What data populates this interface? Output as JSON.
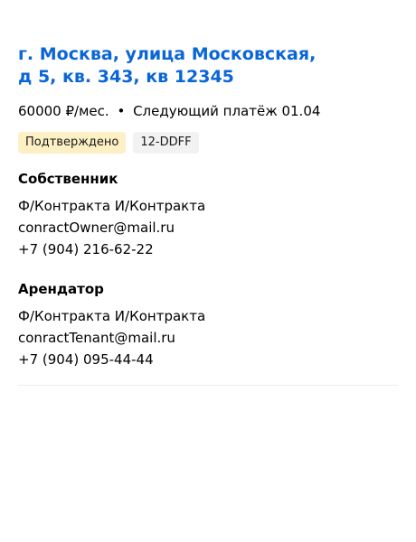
{
  "contract": {
    "address": " г. Москва, улица Московская,\nд 5, кв. 343, кв 12345",
    "price": "60000 ₽/мес.",
    "separator": "•",
    "next_payment": "Следующий платёж 01.04",
    "status_badge": "Подтверждено",
    "id_badge": "12-DDFF",
    "status_badge_color": "#fdf0c5",
    "address_link_color": "#0a66d6"
  },
  "owner": {
    "title": "Собственник",
    "name": "Ф/Контракта И/Контракта",
    "email": "conractOwner@mail.ru",
    "phone": "+7 (904) 216-62-22"
  },
  "tenant": {
    "title": "Арендатор",
    "name": "Ф/Контракта И/Контракта",
    "email": "conractTenant@mail.ru",
    "phone": "+7 (904) 095-44-44"
  }
}
